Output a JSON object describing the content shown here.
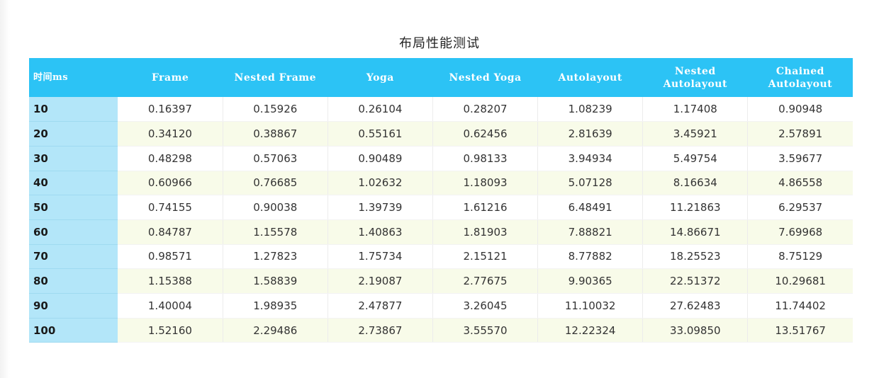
{
  "chart_data": {
    "type": "table",
    "title": "布局性能测试",
    "corner_label": "时间ms",
    "columns": [
      "Frame",
      "Nested Frame",
      "Yoga",
      "Nested Yoga",
      "Autolayout",
      "Nested Autolayout",
      "Chained Autolayout"
    ],
    "column_label_lines": [
      [
        "Frame"
      ],
      [
        "Nested Frame"
      ],
      [
        "Yoga"
      ],
      [
        "Nested Yoga"
      ],
      [
        "Autolayout"
      ],
      [
        "Nested",
        "Autolayout"
      ],
      [
        "Chained",
        "Autolayout"
      ]
    ],
    "rows": [
      {
        "label": "10",
        "values": [
          "0.16397",
          "0.15926",
          "0.26104",
          "0.28207",
          "1.08239",
          "1.17408",
          "0.90948"
        ]
      },
      {
        "label": "20",
        "values": [
          "0.34120",
          "0.38867",
          "0.55161",
          "0.62456",
          "2.81639",
          "3.45921",
          "2.57891"
        ]
      },
      {
        "label": "30",
        "values": [
          "0.48298",
          "0.57063",
          "0.90489",
          "0.98133",
          "3.94934",
          "5.49754",
          "3.59677"
        ]
      },
      {
        "label": "40",
        "values": [
          "0.60966",
          "0.76685",
          "1.02632",
          "1.18093",
          "5.07128",
          "8.16634",
          "4.86558"
        ]
      },
      {
        "label": "50",
        "values": [
          "0.74155",
          "0.90038",
          "1.39739",
          "1.61216",
          "6.48491",
          "11.21863",
          "6.29537"
        ]
      },
      {
        "label": "60",
        "values": [
          "0.84787",
          "1.15578",
          "1.40863",
          "1.81903",
          "7.88821",
          "14.86671",
          "7.69968"
        ]
      },
      {
        "label": "70",
        "values": [
          "0.98571",
          "1.27823",
          "1.75734",
          "2.15121",
          "8.77882",
          "18.25523",
          "8.75129"
        ]
      },
      {
        "label": "80",
        "values": [
          "1.15388",
          "1.58839",
          "2.19087",
          "2.77675",
          "9.90365",
          "22.51372",
          "10.29681"
        ]
      },
      {
        "label": "90",
        "values": [
          "1.40004",
          "1.98935",
          "2.47877",
          "3.26045",
          "11.10032",
          "27.62483",
          "11.74402"
        ]
      },
      {
        "label": "100",
        "values": [
          "1.52160",
          "2.29486",
          "2.73867",
          "3.55570",
          "12.22324",
          "33.09850",
          "13.51767"
        ]
      }
    ],
    "colors": {
      "header_bg": "#2cc3f5",
      "row_label_bg": "#b3e6f9",
      "alt_row_bg": "#f8fbe9"
    }
  }
}
